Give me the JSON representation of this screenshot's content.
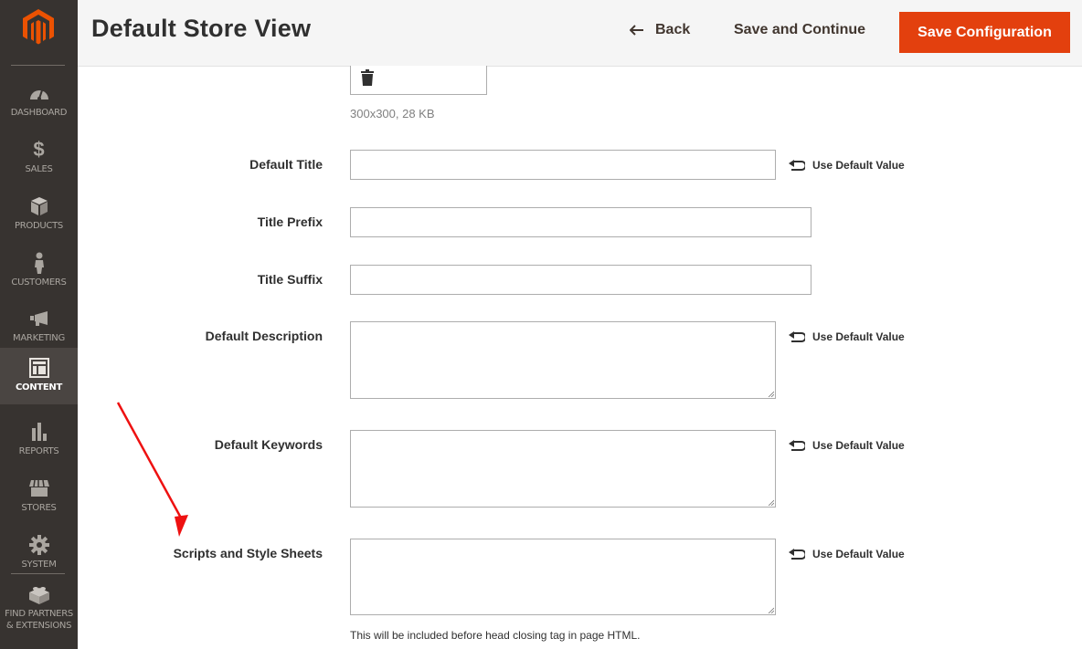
{
  "sidebar": {
    "logo": "magento-logo",
    "items": [
      {
        "label": "DASHBOARD",
        "icon": "dashboard-icon",
        "active": false
      },
      {
        "label": "SALES",
        "icon": "dollar-icon",
        "active": false
      },
      {
        "label": "PRODUCTS",
        "icon": "box-icon",
        "active": false
      },
      {
        "label": "CUSTOMERS",
        "icon": "person-icon",
        "active": false
      },
      {
        "label": "MARKETING",
        "icon": "megaphone-icon",
        "active": false
      },
      {
        "label": "CONTENT",
        "icon": "layout-icon",
        "active": true
      },
      {
        "label": "REPORTS",
        "icon": "bar-chart-icon",
        "active": false
      },
      {
        "label": "STORES",
        "icon": "storefront-icon",
        "active": false
      },
      {
        "label": "SYSTEM",
        "icon": "gear-icon",
        "active": false
      }
    ],
    "partners": {
      "line1": "FIND PARTNERS",
      "line2": "& EXTENSIONS",
      "icon": "lego-brick-icon"
    }
  },
  "header": {
    "title": "Default Store View",
    "back_label": "Back",
    "save_continue_label": "Save and Continue",
    "save_config_label": "Save Configuration",
    "accent_color": "#e3400e"
  },
  "image_field": {
    "meta": "300x300, 28 KB",
    "icon": "trash-icon"
  },
  "fields": {
    "default_title": {
      "label": "Default Title",
      "value": "",
      "use_default": "Use Default Value"
    },
    "title_prefix": {
      "label": "Title Prefix",
      "value": ""
    },
    "title_suffix": {
      "label": "Title Suffix",
      "value": ""
    },
    "default_description": {
      "label": "Default Description",
      "value": "",
      "use_default": "Use Default Value"
    },
    "default_keywords": {
      "label": "Default Keywords",
      "value": "",
      "use_default": "Use Default Value"
    },
    "scripts_styles": {
      "label": "Scripts and Style Sheets",
      "value": "",
      "use_default": "Use Default Value",
      "note": "This will be included before head closing tag in page HTML."
    }
  },
  "annotation": {
    "type": "red-arrow",
    "color": "#ee1111",
    "points_to": "Scripts and Style Sheets"
  }
}
